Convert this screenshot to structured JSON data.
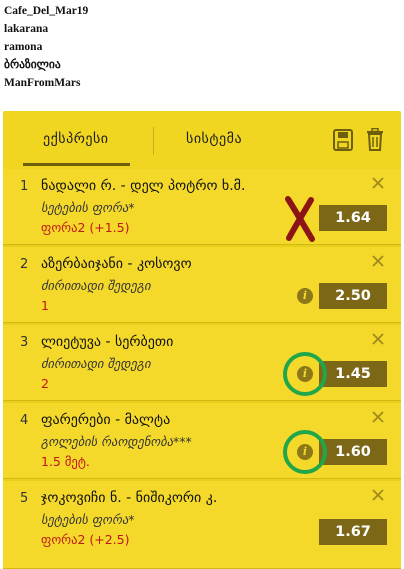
{
  "users": [
    "Cafe_Del_Mar19",
    "lakarana",
    "ramona",
    "ბრაზილია",
    "ManFromMars"
  ],
  "tabs": {
    "express": "ექსპრესი",
    "system": "სისტემა"
  },
  "icons": {
    "save": "save-icon",
    "trash": "trash-icon",
    "close": "close-icon",
    "info": "info-icon"
  },
  "bets": [
    {
      "num": "1",
      "teams": "ნადალი რ. - დელ პოტრო ხ.მ.",
      "market": "სეტების ფორა*",
      "pick": "ფორა2 (+1.5)",
      "odds": "1.64"
    },
    {
      "num": "2",
      "teams": "აზერბაიჯანი - კოსოვო",
      "market": "ძირითადი შედეგი",
      "pick": "1",
      "odds": "2.50",
      "info": "i"
    },
    {
      "num": "3",
      "teams": "ლიეტუვა - სერბეთი",
      "market": "ძირითადი შედეგი",
      "pick": "2",
      "odds": "1.45",
      "info": "i"
    },
    {
      "num": "4",
      "teams": "ფარერები - მალტა",
      "market": "გოლების რაოდენობა***",
      "pick": "1.5 მეტ.",
      "odds": "1.60",
      "info": "i"
    },
    {
      "num": "5",
      "teams": "ჯოკოვიჩი ნ. - ნიშიკორი კ.",
      "market": "სეტების ფორა*",
      "pick": "ფორა2 (+2.5)",
      "odds": "1.67"
    }
  ],
  "colors": {
    "slip_bg": "#f4d92b",
    "odds_bg": "#7c6716",
    "pick_text": "#c01818",
    "circle_annotation": "#21a64a",
    "x_annotation": "#8b1414"
  }
}
